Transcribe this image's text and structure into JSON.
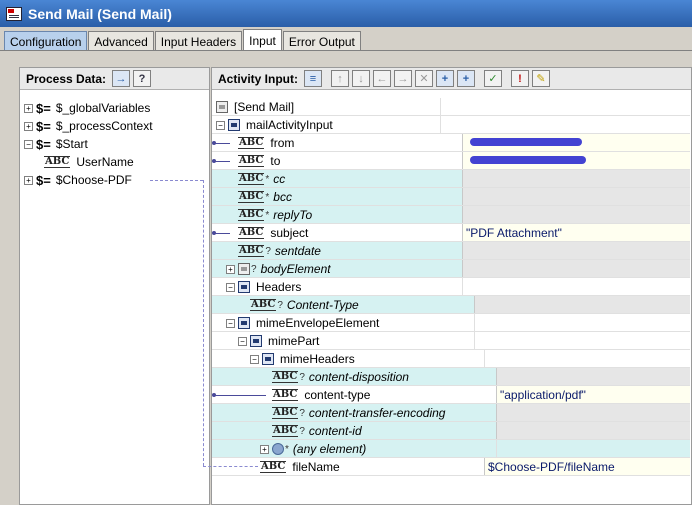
{
  "window": {
    "title": "Send Mail (Send Mail)"
  },
  "tabs": [
    {
      "label": "Configuration"
    },
    {
      "label": "Advanced"
    },
    {
      "label": "Input Headers"
    },
    {
      "label": "Input"
    },
    {
      "label": "Error Output"
    }
  ],
  "process_data": {
    "header": "Process Data:",
    "items": [
      {
        "label": "$_globalVariables"
      },
      {
        "label": "$_processContext"
      },
      {
        "label": "$Start"
      },
      {
        "label": "UserName"
      },
      {
        "label": "$Choose-PDF"
      }
    ]
  },
  "activity_input": {
    "header": "Activity Input:",
    "rows": [
      {
        "label": "[Send Mail]",
        "value": ""
      },
      {
        "label": "mailActivityInput",
        "value": ""
      },
      {
        "label": "from",
        "value": ""
      },
      {
        "label": "to",
        "value": ""
      },
      {
        "label": "cc",
        "value": ""
      },
      {
        "label": "bcc",
        "value": ""
      },
      {
        "label": "replyTo",
        "value": ""
      },
      {
        "label": "subject",
        "value": "\"PDF Attachment\""
      },
      {
        "label": "sentdate",
        "value": ""
      },
      {
        "label": "bodyElement",
        "value": ""
      },
      {
        "label": "Headers",
        "value": ""
      },
      {
        "label": "Content-Type",
        "value": ""
      },
      {
        "label": "mimeEnvelopeElement",
        "value": ""
      },
      {
        "label": "mimePart",
        "value": ""
      },
      {
        "label": "mimeHeaders",
        "value": ""
      },
      {
        "label": "content-disposition",
        "value": ""
      },
      {
        "label": "content-type",
        "value": "\"application/pdf\""
      },
      {
        "label": "content-transfer-encoding",
        "value": ""
      },
      {
        "label": "content-id",
        "value": ""
      },
      {
        "label": "(any element)",
        "value": ""
      },
      {
        "label": "fileName",
        "value": "$Choose-PDF/fileName"
      }
    ]
  },
  "colors": {
    "title_bar": "#2a5ea8",
    "required_row": "#d6f2f2",
    "value_text": "#0a1a6a",
    "mapping_line": "#4a4a9a"
  }
}
